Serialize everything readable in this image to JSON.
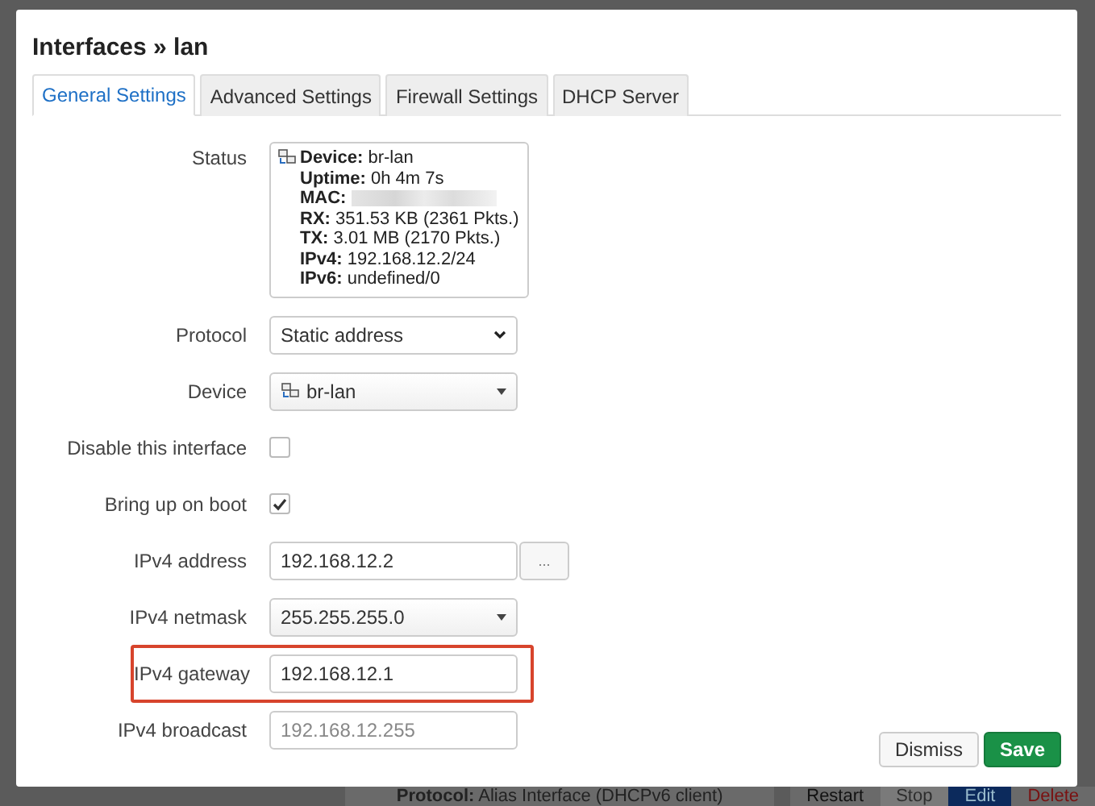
{
  "dialog": {
    "title": "Interfaces » lan",
    "tabs": [
      {
        "label": "General Settings",
        "selected": true
      },
      {
        "label": "Advanced Settings",
        "selected": false
      },
      {
        "label": "Firewall Settings",
        "selected": false
      },
      {
        "label": "DHCP Server",
        "selected": false
      }
    ],
    "status": {
      "label": "Status",
      "lines": [
        {
          "label": "Device:",
          "value": "br-lan"
        },
        {
          "label": "Uptime:",
          "value": "0h 4m 7s"
        },
        {
          "label": "MAC:",
          "kind": "redacted"
        },
        {
          "label": "RX:",
          "value": "351.53 KB (2361 Pkts.)"
        },
        {
          "label": "TX:",
          "value": "3.01 MB (2170 Pkts.)"
        },
        {
          "label": "IPv4:",
          "value": "192.168.12.2/24"
        },
        {
          "label": "IPv6:",
          "value": "undefined/0"
        }
      ]
    },
    "fields": [
      {
        "kind": "select",
        "label": "Protocol",
        "value": "Static address"
      },
      {
        "kind": "device",
        "label": "Device",
        "value": "br-lan"
      },
      {
        "kind": "checkbox",
        "label": "Disable this interface",
        "checked": false
      },
      {
        "kind": "checkbox",
        "label": "Bring up on boot",
        "checked": true
      },
      {
        "kind": "text",
        "label": "IPv4 address",
        "value": "192.168.12.2",
        "button": "..."
      },
      {
        "kind": "combo",
        "label": "IPv4 netmask",
        "value": "255.255.255.0"
      },
      {
        "kind": "text",
        "label": "IPv4 gateway",
        "value": "192.168.12.1",
        "highlighted": true
      },
      {
        "kind": "text",
        "label": "IPv4 broadcast",
        "placeholder": "192.168.12.255"
      }
    ],
    "buttons": [
      {
        "label": "Dismiss",
        "kind": "secondary"
      },
      {
        "label": "Save",
        "kind": "primary"
      }
    ]
  },
  "background_row": {
    "protocol_label": "Protocol:",
    "protocol_value": "Alias Interface (DHCPv6 client)",
    "actions": [
      {
        "label": "Restart",
        "kind": "plain"
      },
      {
        "label": "Stop",
        "kind": "disabled"
      },
      {
        "label": "Edit",
        "kind": "primary"
      },
      {
        "label": "Delete",
        "kind": "danger"
      }
    ]
  }
}
